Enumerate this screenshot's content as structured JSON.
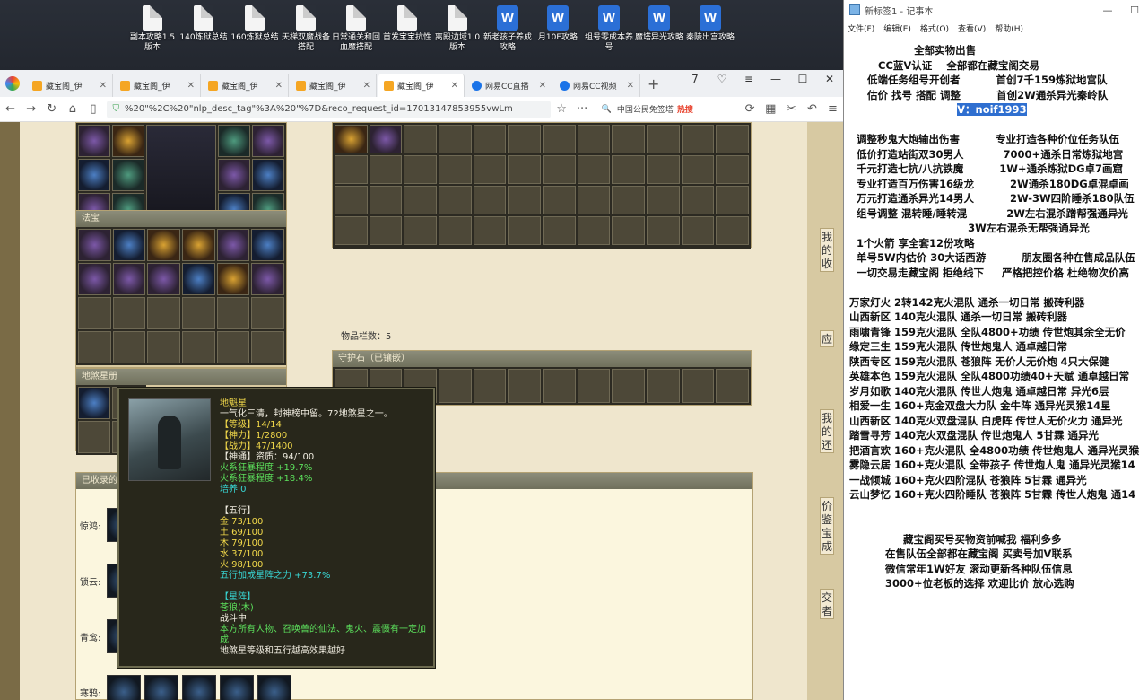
{
  "desktop": {
    "icons": [
      {
        "label": "副本攻略1.5版本",
        "kind": "doc"
      },
      {
        "label": "140炼狱总结",
        "kind": "doc"
      },
      {
        "label": "160炼狱总结",
        "kind": "doc"
      },
      {
        "label": "天梯双魔战备搭配",
        "kind": "doc"
      },
      {
        "label": "日常通关和回血魔搭配",
        "kind": "doc"
      },
      {
        "label": "首发宝宝抗性",
        "kind": "doc"
      },
      {
        "label": "离殿边域1.0版本",
        "kind": "doc"
      },
      {
        "label": "新老孩子养成攻略",
        "kind": "word"
      },
      {
        "label": "月10E攻略",
        "kind": "word"
      },
      {
        "label": "组号零成本养号",
        "kind": "word"
      },
      {
        "label": "魔塔异光攻略",
        "kind": "word"
      },
      {
        "label": "秦陵出宫攻略",
        "kind": "word"
      }
    ]
  },
  "browser": {
    "tabs": [
      {
        "label": "藏宝阁_伊",
        "active": false,
        "fav": "gold"
      },
      {
        "label": "藏宝阁_伊",
        "active": false,
        "fav": "gold"
      },
      {
        "label": "藏宝阁_伊",
        "active": false,
        "fav": "gold"
      },
      {
        "label": "藏宝阁_伊",
        "active": false,
        "fav": "gold"
      },
      {
        "label": "藏宝阁_伊",
        "active": true,
        "fav": "gold"
      },
      {
        "label": "网易CC直播",
        "active": false,
        "fav": "blue"
      },
      {
        "label": "网易CC视频",
        "active": false,
        "fav": "blue"
      }
    ],
    "tab_count": "7",
    "url": "%20\"%2C%20\"nlp_desc_tag\"%3A%20\"%7D&reco_request_id=17013147853955vwLm",
    "search_text": "中国公民免签塔",
    "hot_label": "热搜"
  },
  "game": {
    "fabao_title": "法宝",
    "dishaxing_title": "地煞星册",
    "collected_title": "已收录的",
    "item_count_label": "物品栏数：5",
    "shouhushi_title": "守护石（已镶嵌）",
    "side_labels": [
      "惊鸿:",
      "锁云:",
      "青鸾:",
      "寒鸦:"
    ],
    "right_strip_chars": [
      "我",
      "的",
      "收",
      "藏",
      "应",
      "送",
      "我",
      "的",
      "还",
      "估",
      "价",
      "鉴",
      "宝",
      "成",
      "交",
      "者"
    ]
  },
  "tooltip": {
    "name": "地魁星",
    "desc": "一气化三清，封神榜中留。72地煞星之一。",
    "level": "【等级】14/14",
    "shenli": "【神力】1/2800",
    "zhanli": "【战力】47/1400",
    "zizhi": "【神通】资质：94/100",
    "fire1": "火系狂暴程度 +19.7%",
    "fire2": "火系狂暴程度 +18.4%",
    "peiyang": "培养 0",
    "wuxing_title": "【五行】",
    "jin": "金 73/100",
    "tu": "土 69/100",
    "mu": "木 79/100",
    "shui": "水 37/100",
    "huo": "火 98/100",
    "wuxing_bonus": "五行加成星阵之力 +73.7%",
    "xingzhen_title": "【星阵】",
    "xingzhen_name": "苍狼(木)",
    "state": "战斗中",
    "effect": "本方所有人物、召唤兽的仙法、鬼火、震慑有一定加成",
    "note": "地煞星等级和五行越高效果越好"
  },
  "notepad": {
    "title": "新标签1 - 记事本",
    "menu": [
      "文件(F)",
      "编辑(E)",
      "格式(O)",
      "查看(V)",
      "帮助(H)"
    ],
    "lines": [
      {
        "t": "                  全部实物出售",
        "hl": false
      },
      {
        "t": "        CC蓝V认证    全部都在藏宝阁交易",
        "hl": false
      },
      {
        "t": "     低端任务组号开创者          首创7千159炼狱地宫队",
        "hl": false
      },
      {
        "t": "     估价 找号 搭配 调整          首创2W通杀异光秦岭队",
        "hl": false
      },
      {
        "t": "                              V：noif1993",
        "hl": true
      },
      {
        "t": "",
        "hl": false
      },
      {
        "t": "  调整秒鬼大炮输出伤害          专业打造各种价位任务队伍",
        "hl": false
      },
      {
        "t": "  低价打造站街双30男人           7000+通杀日常炼狱地宫",
        "hl": false
      },
      {
        "t": "  千元打造七抗/八抗铁魔          1W+通杀炼狱DG卓7画窟",
        "hl": false
      },
      {
        "t": "  专业打造百万伤害16级龙          2W通杀180DG卓混卓画",
        "hl": false
      },
      {
        "t": "  万元打造通杀异光14男人          2W-3W四阶睡杀180队伍",
        "hl": false
      },
      {
        "t": "  组号调整 混转睡/睡转混           2W左右混杀蹭帮强通异光",
        "hl": false
      },
      {
        "t": "                                 3W左右混杀无帮强通异光",
        "hl": false
      },
      {
        "t": "  1个火箭 享全套12份攻略",
        "hl": false
      },
      {
        "t": "  单号5W内估价 30大话西游          朋友圈各种在售成品队伍",
        "hl": false
      },
      {
        "t": "  一切交易走藏宝阁 拒绝线下     严格把控价格 杜绝物次价高",
        "hl": false
      },
      {
        "t": "",
        "hl": false
      },
      {
        "t": "万家灯火 2转142克火混队 通杀一切日常 搬砖利器",
        "hl": false
      },
      {
        "t": "山西新区 140克火混队 通杀一切日常 搬砖利器",
        "hl": false
      },
      {
        "t": "雨啸青锋 159克火混队 全队4800+功绩 传世炮其余全无价",
        "hl": false
      },
      {
        "t": "缘定三生 159克火混队 传世炮鬼人 通卓越日常",
        "hl": false
      },
      {
        "t": "陕西专区 159克火混队 苍狼阵 无价人无价炮 4只大保健",
        "hl": false
      },
      {
        "t": "英雄本色 159克火混队 全队4800功绩40+天赋 通卓越日常",
        "hl": false
      },
      {
        "t": "岁月如歌 140克火混队 传世人炮鬼 通卓越日常 异光6层",
        "hl": false
      },
      {
        "t": "相爱一生 160+克金双盘大力队 金牛阵 通异光灵猴14星",
        "hl": false
      },
      {
        "t": "山西新区 140克火双盘混队 白虎阵 传世人无价火力 通异光",
        "hl": false
      },
      {
        "t": "踏雪寻芳 140克火双盘混队 传世炮鬼人 5甘霖 通异光",
        "hl": false
      },
      {
        "t": "把酒言欢 160+克火混队 全4800功绩 传世炮鬼人 通异光灵猴",
        "hl": false
      },
      {
        "t": "雾隐云居 160+克火混队 全带孩子 传世炮人鬼 通异光灵猴14",
        "hl": false
      },
      {
        "t": "一战倾城 160+克火四阶混队 苍狼阵 5甘霖 通异光",
        "hl": false
      },
      {
        "t": "云山梦忆 160+克火四阶睡队 苍狼阵 5甘霖 传世人炮鬼 通14",
        "hl": false
      },
      {
        "t": "",
        "hl": false
      },
      {
        "t": "",
        "hl": false
      },
      {
        "t": "               藏宝阁买号买物资前喊我 福利多多",
        "hl": false
      },
      {
        "t": "          在售队伍全部都在藏宝阁 买卖号加V联系",
        "hl": false
      },
      {
        "t": "          微信常年1W好友 滚动更新各种队伍信息",
        "hl": false
      },
      {
        "t": "          3000+位老板的选择 欢迎比价 放心选购",
        "hl": false
      }
    ]
  }
}
